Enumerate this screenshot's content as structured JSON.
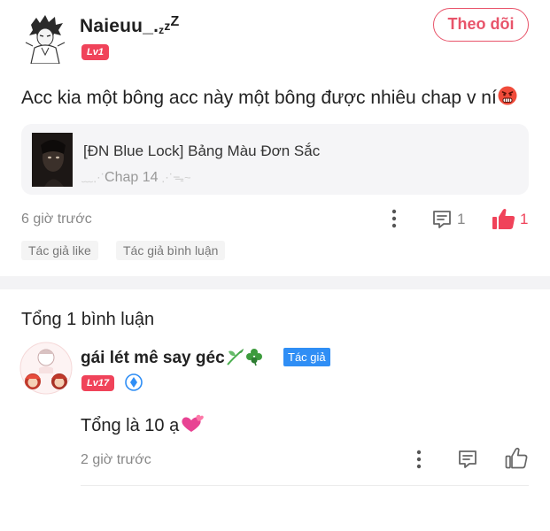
{
  "post": {
    "username": "Naieuu_.",
    "username_sleep": "zzZ",
    "level": "Lv1",
    "follow_label": "Theo dõi",
    "text": "Acc kia một bông acc này một bông được nhiêu chap v ní",
    "story": {
      "title": "[ĐN Blue Lock] Bảng Màu Đơn Sắc",
      "chapter": "Chap 14"
    },
    "time": "6 giờ trước",
    "comment_count": "1",
    "like_count": "1",
    "tags": [
      "Tác giả like",
      "Tác giả bình luận"
    ]
  },
  "comments_section": {
    "title": "Tổng 1 bình luận",
    "comments": [
      {
        "name": "gái lét mê say géc",
        "author_tag": "Tác giả",
        "level": "Lv17",
        "text": "Tổng là 10 ạ",
        "time": "2 giờ trước"
      }
    ]
  },
  "colors": {
    "accent": "#e8546a",
    "like_red": "#f0435a",
    "author_blue": "#2f8ef5",
    "muted": "#888888"
  },
  "icons": [
    "sleep-zzz-icon",
    "angry-face-emoji-icon",
    "more-dots-icon",
    "comment-icon",
    "thumbs-up-filled-icon",
    "seedling-icon",
    "clover-icon",
    "diamond-badge-icon",
    "hearts-emoji-icon",
    "thumbs-up-outline-icon"
  ]
}
